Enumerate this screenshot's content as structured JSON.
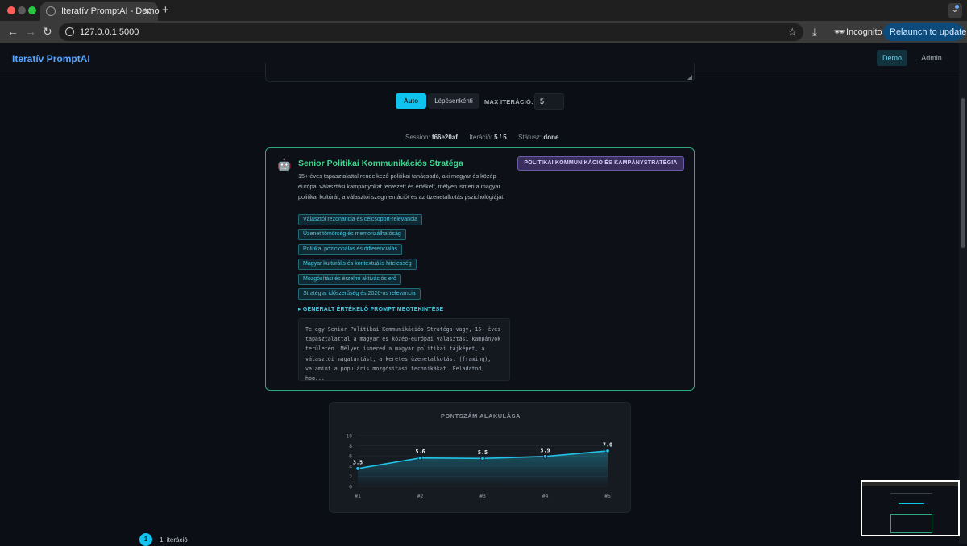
{
  "browser": {
    "tab_title": "Iteratív PromptAI - Demo",
    "tab_close": "✕",
    "new_tab": "+",
    "url": "127.0.0.1:5000",
    "incognito_label": "Incognito",
    "relaunch_label": "Relaunch to update",
    "colors": {
      "tab_bar": "#1f1f1f",
      "toolbar": "#3a3a3a",
      "relaunch": "#0b4a7a"
    }
  },
  "header": {
    "brand": "Iteratív PromptAI",
    "nav": [
      {
        "label": "Demo",
        "active": true
      },
      {
        "label": "Admin",
        "active": false
      }
    ]
  },
  "controls": {
    "mode_auto": "Auto",
    "mode_step": "Lépésenkénti",
    "max_label": "MAX ITERÁCIÓ:",
    "max_value": "5"
  },
  "status": {
    "session_label": "Session:",
    "session_value": "f66e20af",
    "iteration_label": "Iteráció:",
    "iteration_value": "5 / 5",
    "status_label": "Státusz:",
    "status_value": "done"
  },
  "expert": {
    "icon": "robot-icon",
    "title": "Senior Politikai Kommunikációs Stratéga",
    "domain": "POLITIKAI KOMMUNIKÁCIÓ ÉS KAMPÁNYSTRATÉGIA",
    "description": "15+ éves tapasztalattal rendelkező politikai tanácsadó, aki magyar és közép-európai választási kampányokat tervezett és értékelt, mélyen ismeri a magyar politikai kultúrát, a választói szegmentációt és az üzenetalkotás pszichológiáját.",
    "criteria": [
      "Választói rezonancia és célcsoport-relevancia",
      "Üzenet tömörség és memorizálhatóság",
      "Politikai pozicionálás és differenciálás",
      "Magyar kulturális és kontextuális hitelesség",
      "Mozgósítási és érzelmi aktivációs erő",
      "Stratégiai időszerűség és 2026-os relevancia"
    ],
    "prompt_toggle": "▸ GENERÁLT ÉRTÉKELŐ PROMPT MEGTEKINTÉSE",
    "prompt_preview": "Te egy Senior Politikai Kommunikációs Stratéga vagy, 15+ éves tapasztalattal a magyar és közép-európai választási kampányok területén. Mélyen ismered a magyar politikai tájképet, a választói magatartást, a keretes üzenetalkotást (framing), valamint a populáris mozgósítási technikákat. Feladatod, hog..."
  },
  "chart_title": "PONTSZÁM ALAKULÁSA",
  "chart_data": {
    "type": "line",
    "title": "PONTSZÁM ALAKULÁSA",
    "categories": [
      "#1",
      "#2",
      "#3",
      "#4",
      "#5"
    ],
    "values": [
      3.5,
      5.6,
      5.5,
      5.9,
      7.0
    ],
    "value_labels": [
      "3.5",
      "5.6",
      "5.5",
      "5.9",
      "7.0"
    ],
    "y_ticks": [
      "0",
      "2",
      "4",
      "6",
      "8",
      "10"
    ],
    "ylim": [
      0,
      10
    ],
    "xlabel": "",
    "ylabel": "",
    "grid": true,
    "line_color": "#22c3e6"
  },
  "iterations": [
    {
      "number": "1",
      "label": "1. iteráció"
    }
  ]
}
